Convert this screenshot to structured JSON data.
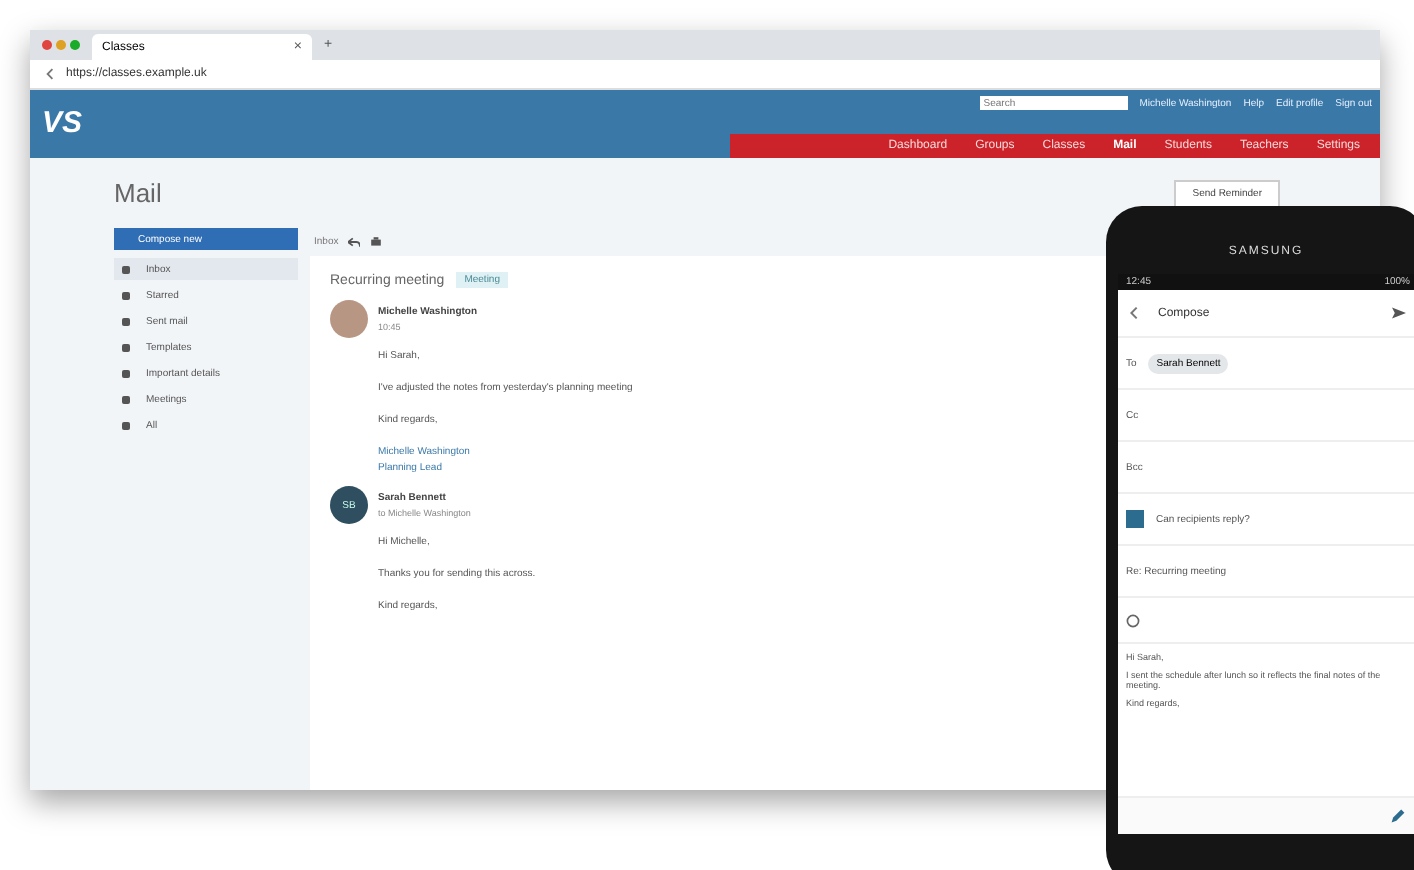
{
  "browser": {
    "tab_title": "Classes",
    "tab_close": "×",
    "new_tab": "+",
    "url": "https://classes.example.uk"
  },
  "header": {
    "logo": "VS",
    "search_placeholder": "Search",
    "user": "Michelle Washington",
    "links": [
      "Help",
      "Edit profile",
      "Sign out"
    ]
  },
  "nav": [
    {
      "label": "Dashboard",
      "selected": false
    },
    {
      "label": "Groups",
      "selected": false
    },
    {
      "label": "Classes",
      "selected": false
    },
    {
      "label": "Mail",
      "selected": true
    },
    {
      "label": "Students",
      "selected": false
    },
    {
      "label": "Teachers",
      "selected": false
    },
    {
      "label": "Settings",
      "selected": false
    }
  ],
  "page_title": "Mail",
  "send_button": "Send Reminder",
  "sidebar": {
    "compose": "Compose new",
    "items": [
      {
        "label": "Inbox",
        "selected": true
      },
      {
        "label": "Starred",
        "selected": false
      },
      {
        "label": "Sent mail",
        "selected": false
      },
      {
        "label": "Templates",
        "selected": false
      },
      {
        "label": "Important details",
        "selected": false
      },
      {
        "label": "Meetings",
        "selected": false
      },
      {
        "label": "All",
        "selected": false
      }
    ]
  },
  "toolbar": {
    "back": "Inbox"
  },
  "thread": {
    "subject": "Recurring meeting",
    "tag": "Meeting",
    "messages": [
      {
        "sender": "Michelle Washington",
        "meta": "10:45",
        "kind": "photo",
        "lines": [
          "Hi Sarah,",
          "I've adjusted the notes from yesterday's planning meeting",
          "Kind regards,"
        ],
        "signature": [
          "Michelle Washington",
          "Planning Lead"
        ]
      },
      {
        "sender": "Sarah Bennett",
        "meta": "to Michelle Washington",
        "kind": "initials",
        "initials": "SB",
        "lines": [
          "Hi Michelle,",
          "Thanks you for sending this across.",
          "Kind regards,"
        ]
      }
    ]
  },
  "phone": {
    "brand": "SAMSUNG",
    "time": "12:45",
    "status": "100%",
    "title": "Compose",
    "to_label": "To",
    "recipient": "Sarah Bennett",
    "cc_label": "Cc",
    "bcc_label": "Bcc",
    "reply_checkbox": {
      "label": "Can recipients reply?",
      "checked": true
    },
    "subject": "Re: Recurring meeting",
    "body": [
      "Hi Sarah,",
      "I sent the schedule after lunch so it reflects the final notes of the meeting.",
      "Kind regards,"
    ]
  }
}
